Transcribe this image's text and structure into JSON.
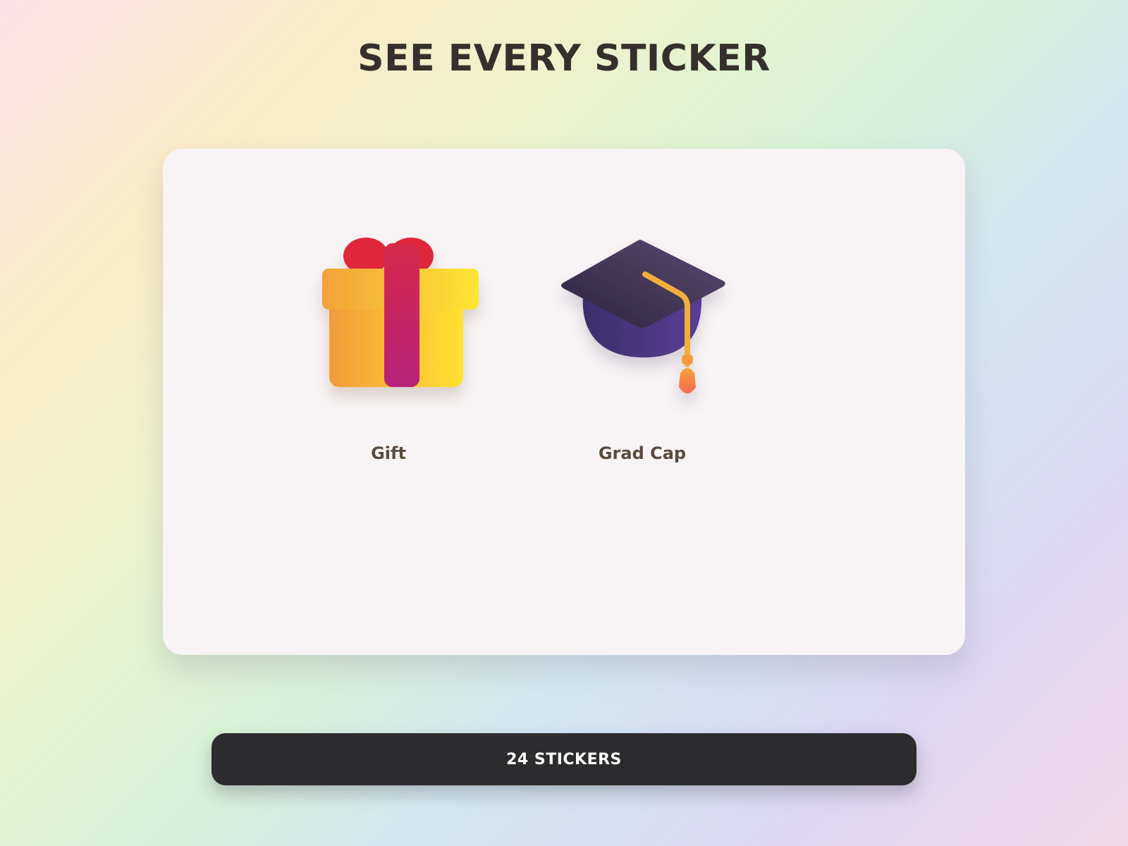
{
  "page": {
    "title": "SEE EVERY STICKER"
  },
  "stickers": [
    {
      "label": "Gift",
      "icon": "gift-icon"
    },
    {
      "label": "Grad Cap",
      "icon": "graduation-cap-icon"
    }
  ],
  "footer": {
    "count_label": "24 STICKERS"
  },
  "colors": {
    "title": "#35302b",
    "card_bg": "#f8f4f5",
    "button_bg": "#2c2b2e",
    "label": "#5a4a3e"
  }
}
